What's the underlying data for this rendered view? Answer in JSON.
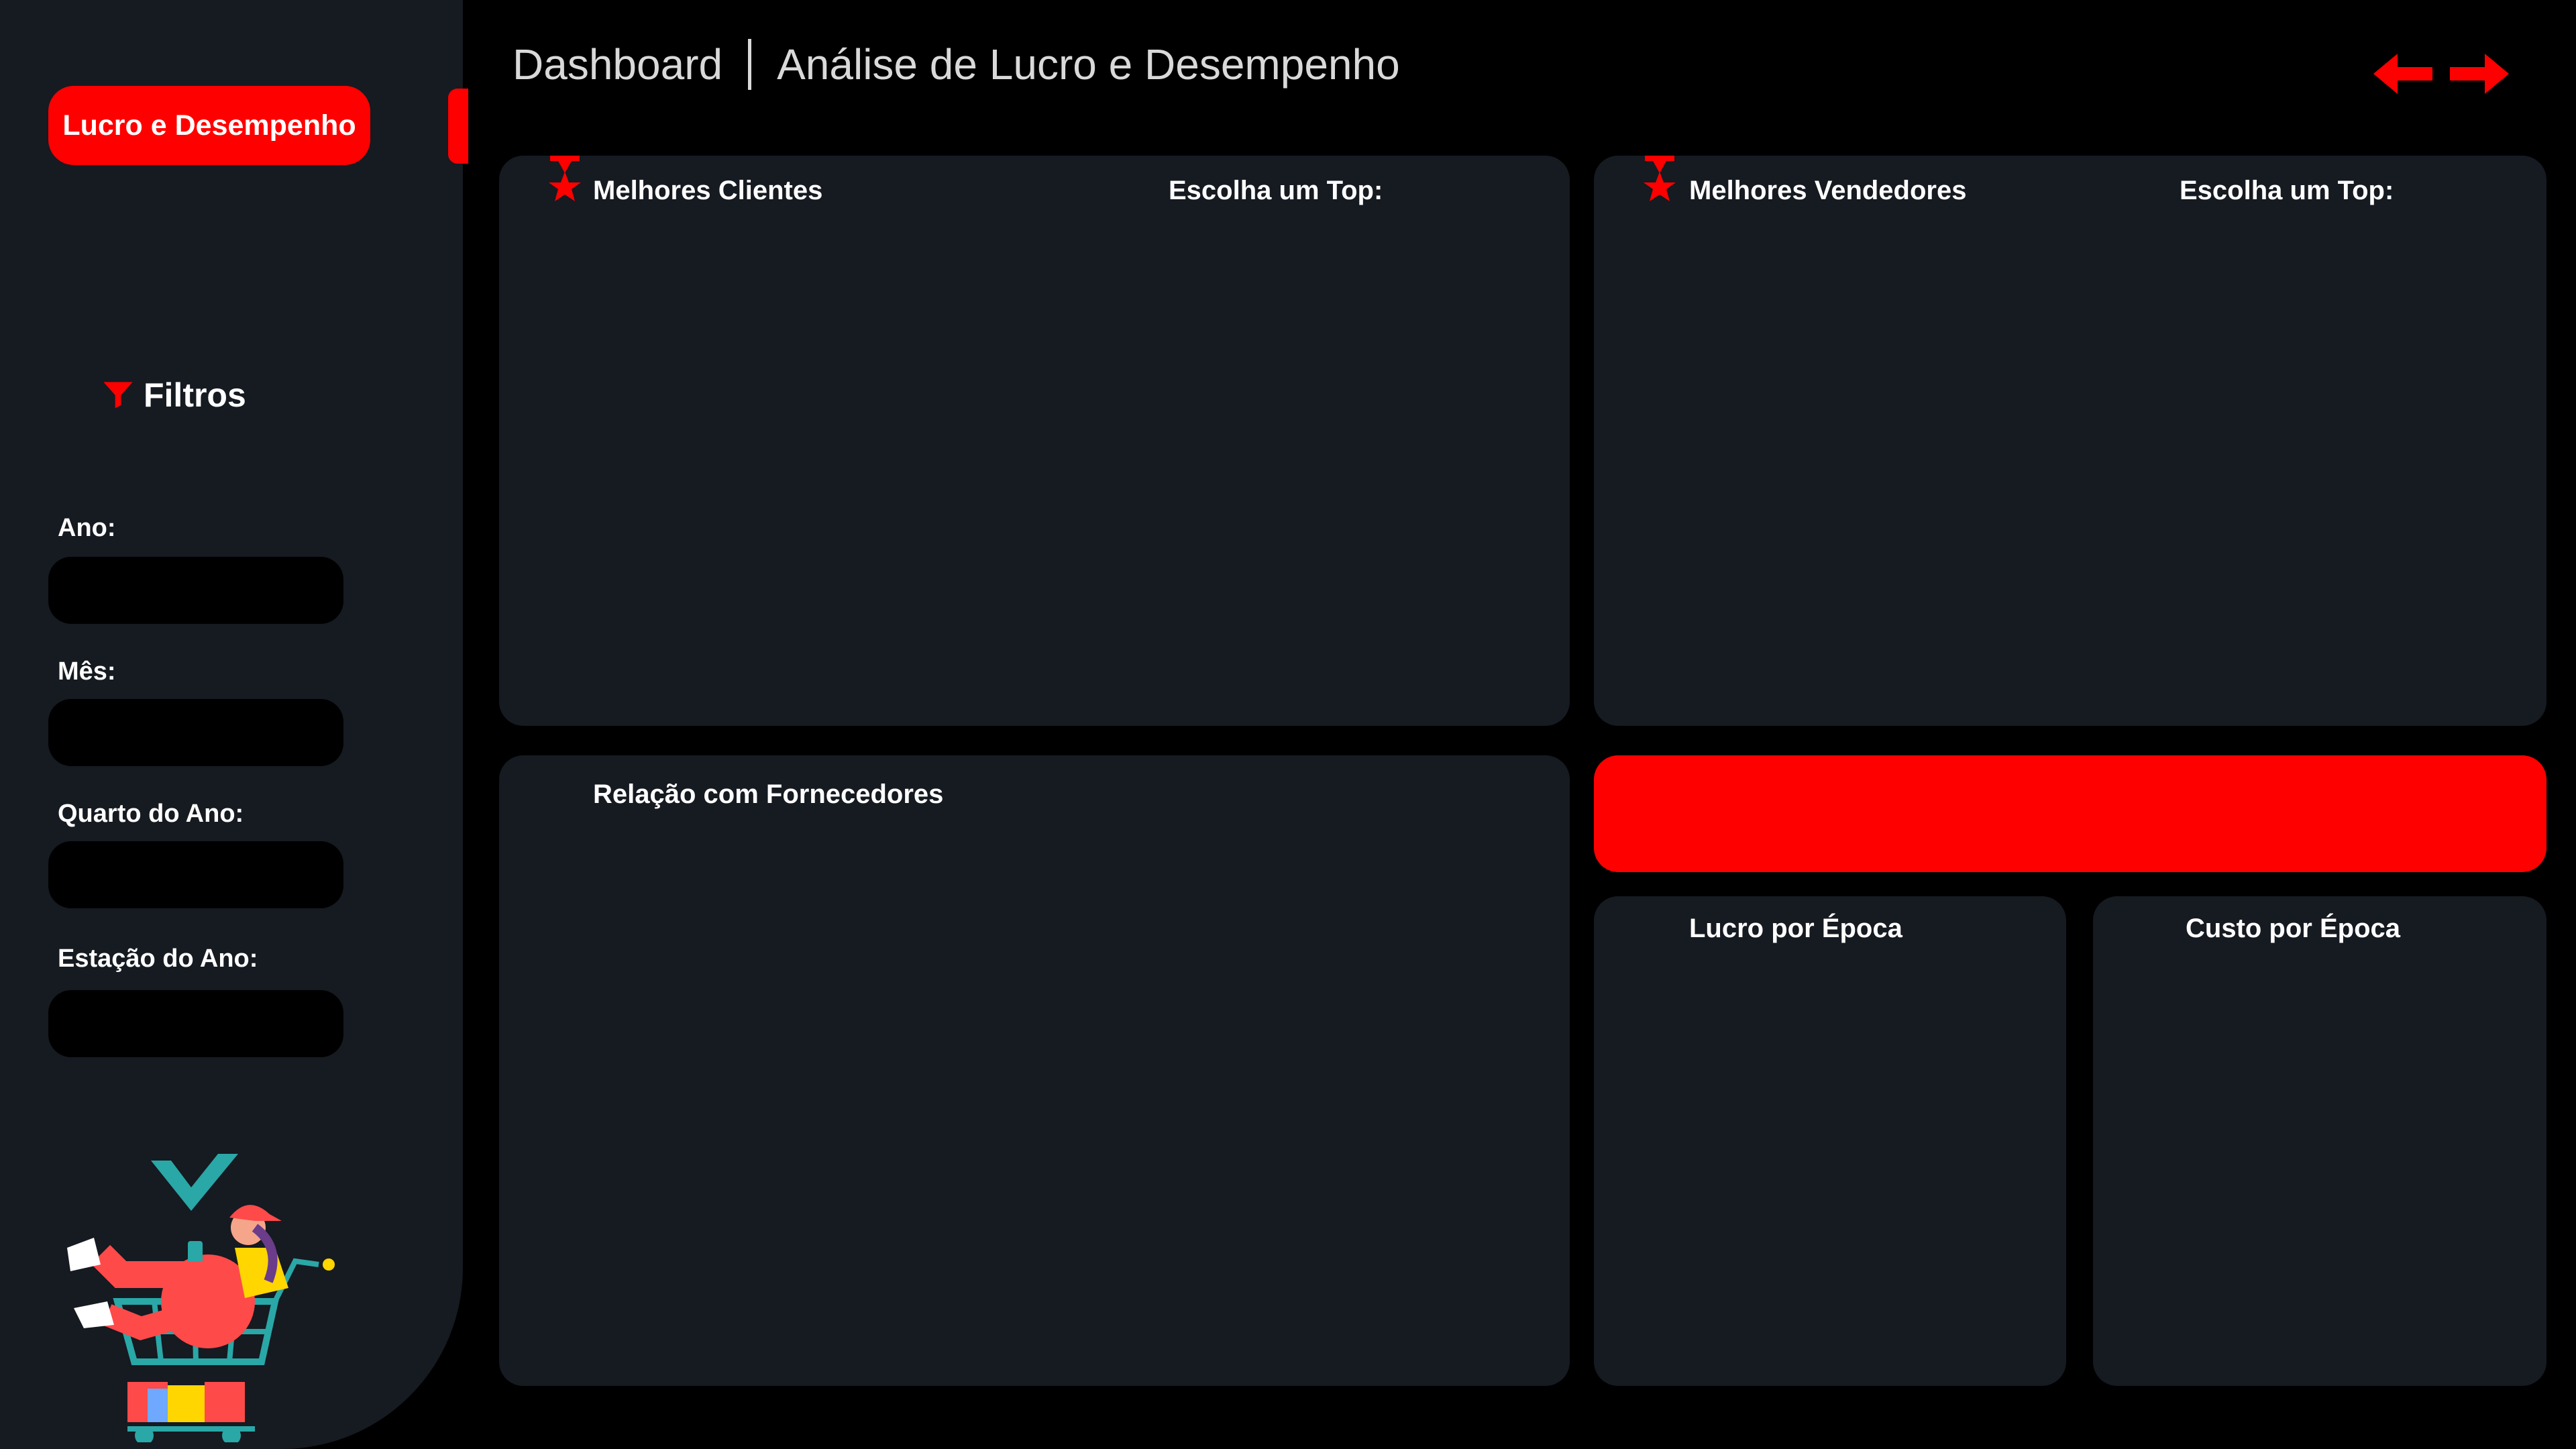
{
  "sidebar": {
    "tab_label": "Lucro e Desempenho",
    "filters_title": "Filtros",
    "filters": [
      {
        "label": "Ano:"
      },
      {
        "label": "Mês:"
      },
      {
        "label": "Quarto do Ano:"
      },
      {
        "label": "Estação do Ano:"
      }
    ]
  },
  "header": {
    "title": "Dashboard",
    "subtitle": "Análise de Lucro e Desempenho"
  },
  "panels": {
    "best_clients": {
      "title": "Melhores Clientes",
      "top_label": "Escolha um Top:"
    },
    "best_sellers": {
      "title": "Melhores Vendedores",
      "top_label": "Escolha um Top:"
    },
    "suppliers": {
      "title": "Relação com Fornecedores"
    },
    "profit_season": {
      "title": "Lucro por Época"
    },
    "cost_season": {
      "title": "Custo por Época"
    }
  },
  "colors": {
    "accent": "#ff0000",
    "panel": "#161a21",
    "background": "#000000"
  },
  "icons": [
    "funnel-icon",
    "award-star-icon",
    "arrow-left-icon",
    "arrow-right-icon",
    "shopping-cart-illustration"
  ]
}
